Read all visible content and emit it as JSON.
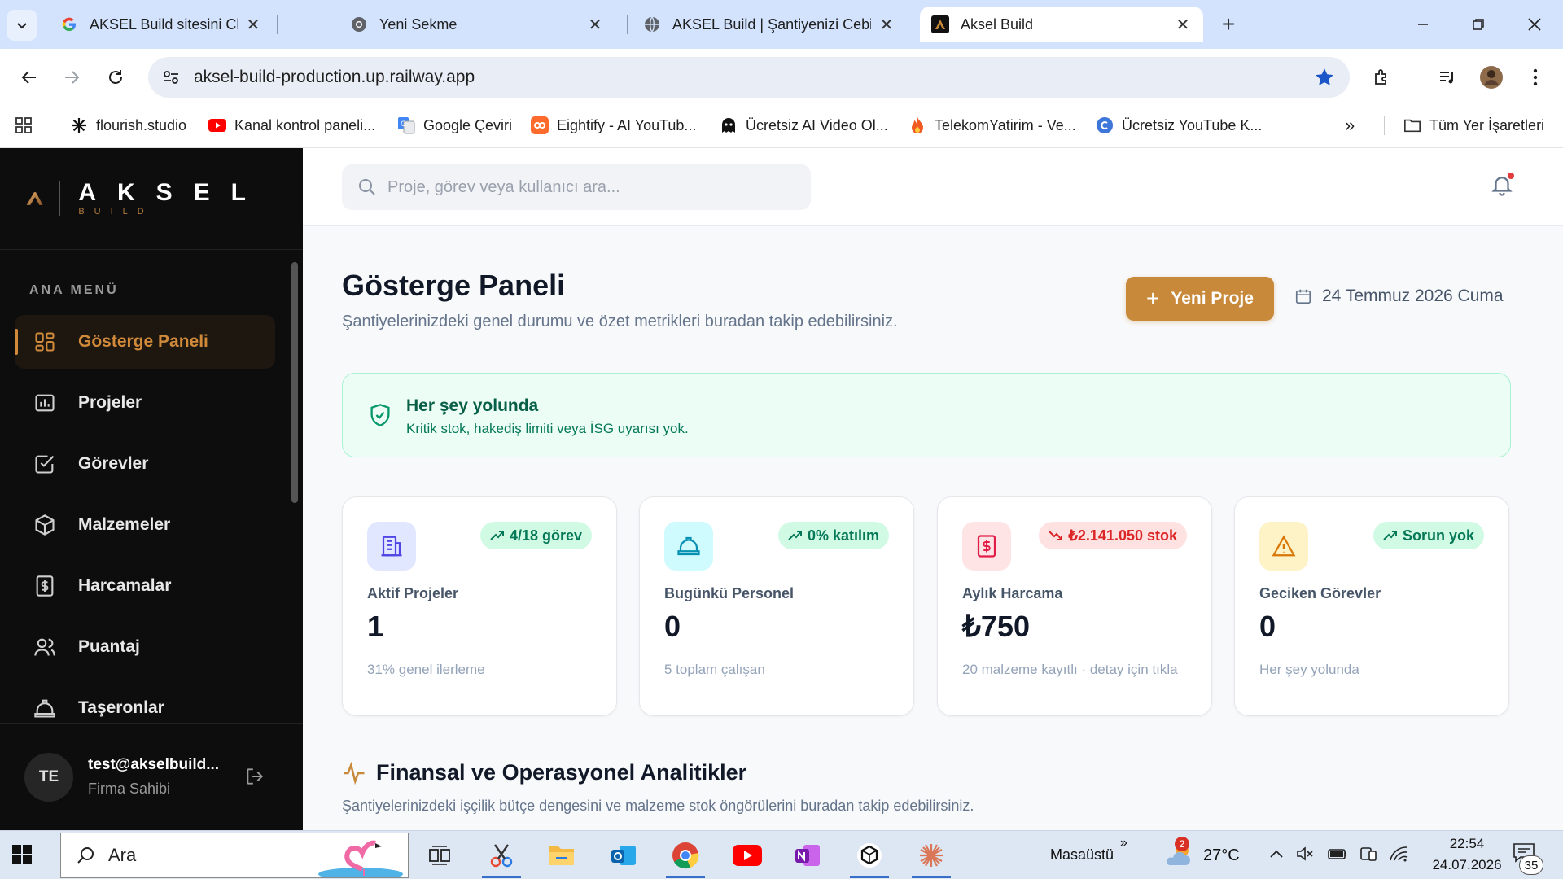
{
  "browser": {
    "tabs": [
      {
        "title": "AKSEL Build sitesini Chrome'da",
        "favicon": "google-icon"
      },
      {
        "title": "Yeni Sekme",
        "favicon": "chrome-icon"
      },
      {
        "title": "AKSEL Build | Şantiyenizi Cebinize",
        "favicon": "globe-icon"
      },
      {
        "title": "Aksel Build",
        "favicon": "aksel-icon"
      }
    ],
    "url": "aksel-build-production.up.railway.app",
    "bookmarks": [
      {
        "label": "flourish.studio"
      },
      {
        "label": "Kanal kontrol paneli..."
      },
      {
        "label": "Google Çeviri"
      },
      {
        "label": "Eightify - AI YouTub..."
      },
      {
        "label": "Ücretsiz AI Video Ol..."
      },
      {
        "label": "TelekomYatirim - Ve..."
      },
      {
        "label": "Ücretsiz YouTube K..."
      }
    ],
    "all_bookmarks": "Tüm Yer İşaretleri"
  },
  "sidebar": {
    "logo_main": "AKSEL",
    "logo_sub": "BUILD",
    "menu_heading": "ANA MENÜ",
    "items": [
      {
        "label": "Gösterge Paneli",
        "icon": "grid-icon"
      },
      {
        "label": "Projeler",
        "icon": "chart-icon"
      },
      {
        "label": "Görevler",
        "icon": "checkbox-icon"
      },
      {
        "label": "Malzemeler",
        "icon": "box-icon"
      },
      {
        "label": "Harcamalar",
        "icon": "dollar-icon"
      },
      {
        "label": "Puantaj",
        "icon": "users-icon"
      },
      {
        "label": "Taşeronlar",
        "icon": "helmet-icon"
      }
    ],
    "user": {
      "initials": "TE",
      "email": "test@akselbuild...",
      "role": "Firma Sahibi"
    }
  },
  "header": {
    "search_placeholder": "Proje, görev veya kullanıcı ara..."
  },
  "page": {
    "title": "Gösterge Paneli",
    "subtitle": "Şantiyelerinizdeki genel durumu ve özet metrikleri buradan takip edebilirsiniz.",
    "new_project_label": "Yeni Proje",
    "date": "24 Temmuz 2026 Cuma"
  },
  "status_banner": {
    "title": "Her şey yolunda",
    "message": "Kritik stok, hakediş limiti veya İSG uyarısı yok."
  },
  "cards": [
    {
      "label": "Aktif Projeler",
      "value": "1",
      "badge": "4/18 görev",
      "note": "31% genel ilerleme",
      "icon": "building-icon"
    },
    {
      "label": "Bugünkü Personel",
      "value": "0",
      "badge": "0% katılım",
      "note": "5 toplam çalışan",
      "icon": "helmet-icon"
    },
    {
      "label": "Aylık Harcama",
      "value": "₺750",
      "badge": "₺2.141.050 stok",
      "note": "20 malzeme kayıtlı · detay için tıkla",
      "icon": "receipt-icon"
    },
    {
      "label": "Geciken Görevler",
      "value": "0",
      "badge": "Sorun yok",
      "note": "Her şey yolunda",
      "icon": "warning-icon"
    }
  ],
  "analytics": {
    "title": "Finansal ve Operasyonel Analitikler",
    "subtitle": "Şantiyelerinizdeki işçilik bütçe dengesini ve malzeme stok öngörülerini buradan takip edebilirsiniz."
  },
  "taskbar": {
    "search_label": "Ara",
    "desktop_label": "Masaüstü",
    "weather_temp": "27°C",
    "weather_badge": "2",
    "time": "22:54",
    "date": "24.07.2026",
    "notification_count": "35"
  },
  "colors": {
    "accent": "#c9893a",
    "sidebar_bg": "#0d0d0d",
    "success_bg": "#ecfdf5"
  }
}
